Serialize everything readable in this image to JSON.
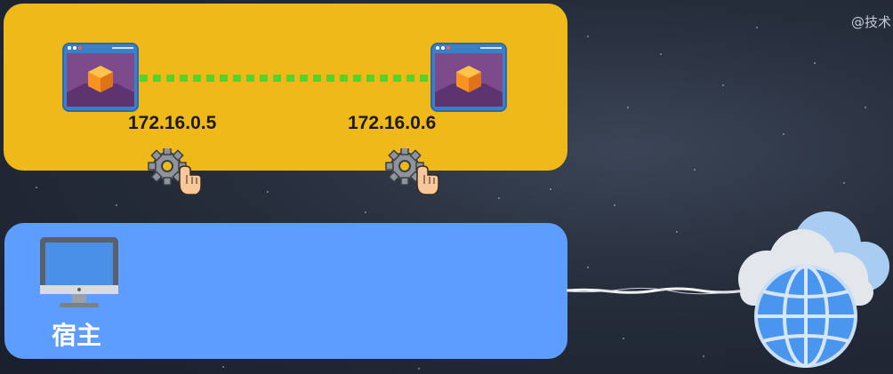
{
  "watermark": "@技术",
  "colors": {
    "container_panel": "#efba19",
    "host_panel": "#5c9dff",
    "link_line": "#4fd62b",
    "background": "#262d3b"
  },
  "containers": [
    {
      "ip": "172.16.0.5",
      "icon": "container-window-icon",
      "interface_icon": "gear-hand-icon"
    },
    {
      "ip": "172.16.0.6",
      "icon": "container-window-icon",
      "interface_icon": "gear-hand-icon"
    }
  ],
  "host": {
    "label": "宿主",
    "icon": "monitor-icon"
  },
  "network": {
    "icon": "cloud-globe-icon"
  }
}
